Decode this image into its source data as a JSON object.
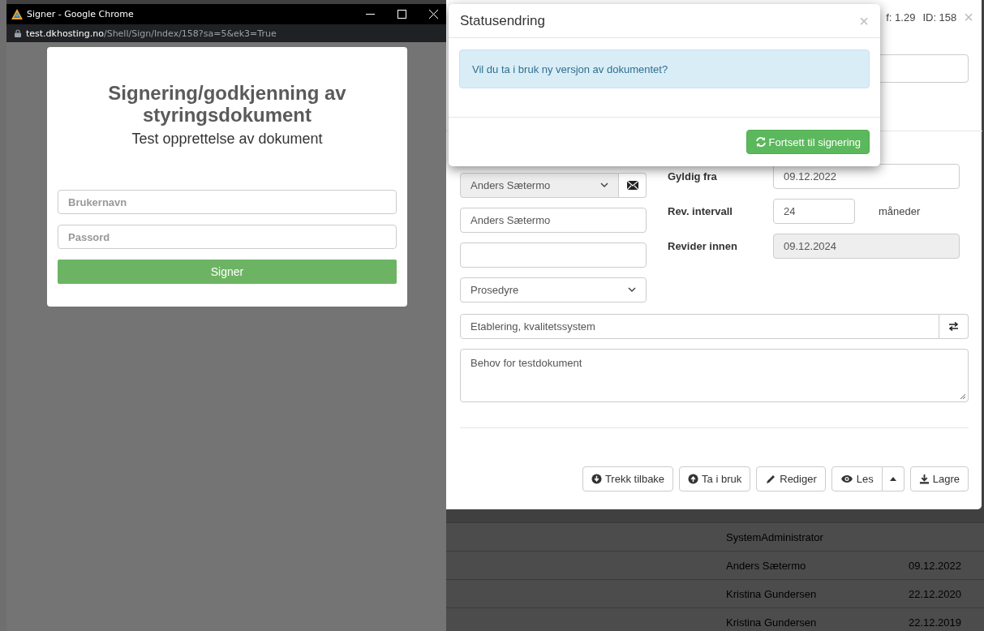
{
  "popup_window": {
    "title": "Signer - Google Chrome",
    "url_host": "test.dkhosting.no",
    "url_path": "/Shell/Sign/Index/158?sa=5&ek3=True",
    "card": {
      "heading": "Signering/godkjenning av styringsdokument",
      "subheading": "Test opprettelse av dokument",
      "username": {
        "placeholder": "Brukernavn"
      },
      "password": {
        "placeholder": "Passord"
      },
      "submit": "Signer"
    }
  },
  "document_dialog": {
    "header_info": [
      "f: 1.29",
      "ID: 158"
    ],
    "close": "×",
    "responsible_select": "Anders Sætermo",
    "author_field": "Anders Sætermo",
    "type_select": "Prosedyre",
    "dates": [
      {
        "label": "Gyldig fra",
        "value": "09.12.2022",
        "disabled": false
      },
      {
        "label": "Rev. intervall",
        "value": "24",
        "unit": "måneder",
        "disabled": false
      },
      {
        "label": "Revider innen",
        "value": "09.12.2024",
        "disabled": true
      }
    ],
    "category_field": "Etablering, kvalitetssystem",
    "description": "Behov for testdokument",
    "buttons": [
      {
        "kind": "retract",
        "label": "Trekk tilbake"
      },
      {
        "kind": "activate",
        "label": "Ta i bruk"
      },
      {
        "kind": "edit",
        "label": "Rediger"
      },
      {
        "kind": "read",
        "label": "Les"
      },
      {
        "kind": "save",
        "label": "Lagre"
      }
    ]
  },
  "status_modal": {
    "title": "Statusendring",
    "close": "×",
    "message": "Vil du ta i bruk ny versjon av dokumentet?",
    "confirm": "Fortsett til signering"
  },
  "background_rows": [
    {
      "name": "SystemAdministrator"
    },
    {
      "name": "Anders Sætermo",
      "date": "09.12.2022"
    },
    {
      "name": "Kristina Gundersen",
      "date": "22.12.2020"
    },
    {
      "name": "Kristina Gundersen",
      "date": "22.12.2019"
    }
  ]
}
